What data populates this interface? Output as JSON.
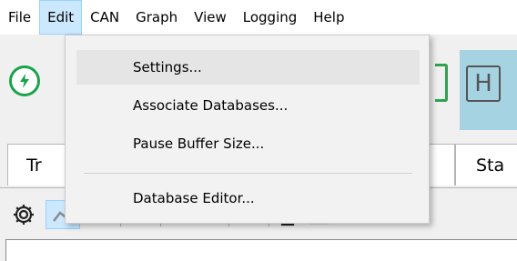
{
  "menubar": {
    "items": [
      "File",
      "Edit",
      "CAN",
      "Graph",
      "View",
      "Logging",
      "Help"
    ],
    "active": "Edit"
  },
  "edit_menu": {
    "items": [
      "Settings...",
      "Associate Databases...",
      "Pause Buffer Size...",
      "Database Editor..."
    ],
    "highlighted": "Settings..."
  },
  "toolbar": {
    "connect_icon": "lightning-bolt-icon",
    "h_button_label": "H"
  },
  "tabs": [
    "Tr",
    "Sta"
  ],
  "icon_row": {
    "icons": [
      "gear-icon",
      "autoscale-icon",
      "wave-icon",
      "frame-icon",
      "play-step-icon",
      "pause-icon",
      "clear-icon",
      "print-icon",
      "image-icon"
    ]
  },
  "colors": {
    "menu_active": "#cce8ff",
    "menu_highlight": "#e5e5e5",
    "connect_green": "#1aa34a",
    "panel_blue": "#a6d3e1"
  }
}
